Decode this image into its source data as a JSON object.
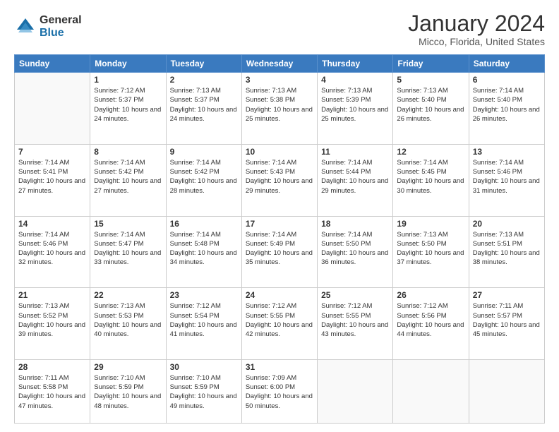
{
  "logo": {
    "general": "General",
    "blue": "Blue"
  },
  "title": "January 2024",
  "location": "Micco, Florida, United States",
  "weekdays": [
    "Sunday",
    "Monday",
    "Tuesday",
    "Wednesday",
    "Thursday",
    "Friday",
    "Saturday"
  ],
  "weeks": [
    [
      {
        "day": "",
        "info": ""
      },
      {
        "day": "1",
        "info": "Sunrise: 7:12 AM\nSunset: 5:37 PM\nDaylight: 10 hours\nand 24 minutes."
      },
      {
        "day": "2",
        "info": "Sunrise: 7:13 AM\nSunset: 5:37 PM\nDaylight: 10 hours\nand 24 minutes."
      },
      {
        "day": "3",
        "info": "Sunrise: 7:13 AM\nSunset: 5:38 PM\nDaylight: 10 hours\nand 25 minutes."
      },
      {
        "day": "4",
        "info": "Sunrise: 7:13 AM\nSunset: 5:39 PM\nDaylight: 10 hours\nand 25 minutes."
      },
      {
        "day": "5",
        "info": "Sunrise: 7:13 AM\nSunset: 5:40 PM\nDaylight: 10 hours\nand 26 minutes."
      },
      {
        "day": "6",
        "info": "Sunrise: 7:14 AM\nSunset: 5:40 PM\nDaylight: 10 hours\nand 26 minutes."
      }
    ],
    [
      {
        "day": "7",
        "info": "Sunrise: 7:14 AM\nSunset: 5:41 PM\nDaylight: 10 hours\nand 27 minutes."
      },
      {
        "day": "8",
        "info": "Sunrise: 7:14 AM\nSunset: 5:42 PM\nDaylight: 10 hours\nand 27 minutes."
      },
      {
        "day": "9",
        "info": "Sunrise: 7:14 AM\nSunset: 5:42 PM\nDaylight: 10 hours\nand 28 minutes."
      },
      {
        "day": "10",
        "info": "Sunrise: 7:14 AM\nSunset: 5:43 PM\nDaylight: 10 hours\nand 29 minutes."
      },
      {
        "day": "11",
        "info": "Sunrise: 7:14 AM\nSunset: 5:44 PM\nDaylight: 10 hours\nand 29 minutes."
      },
      {
        "day": "12",
        "info": "Sunrise: 7:14 AM\nSunset: 5:45 PM\nDaylight: 10 hours\nand 30 minutes."
      },
      {
        "day": "13",
        "info": "Sunrise: 7:14 AM\nSunset: 5:46 PM\nDaylight: 10 hours\nand 31 minutes."
      }
    ],
    [
      {
        "day": "14",
        "info": "Sunrise: 7:14 AM\nSunset: 5:46 PM\nDaylight: 10 hours\nand 32 minutes."
      },
      {
        "day": "15",
        "info": "Sunrise: 7:14 AM\nSunset: 5:47 PM\nDaylight: 10 hours\nand 33 minutes."
      },
      {
        "day": "16",
        "info": "Sunrise: 7:14 AM\nSunset: 5:48 PM\nDaylight: 10 hours\nand 34 minutes."
      },
      {
        "day": "17",
        "info": "Sunrise: 7:14 AM\nSunset: 5:49 PM\nDaylight: 10 hours\nand 35 minutes."
      },
      {
        "day": "18",
        "info": "Sunrise: 7:14 AM\nSunset: 5:50 PM\nDaylight: 10 hours\nand 36 minutes."
      },
      {
        "day": "19",
        "info": "Sunrise: 7:13 AM\nSunset: 5:50 PM\nDaylight: 10 hours\nand 37 minutes."
      },
      {
        "day": "20",
        "info": "Sunrise: 7:13 AM\nSunset: 5:51 PM\nDaylight: 10 hours\nand 38 minutes."
      }
    ],
    [
      {
        "day": "21",
        "info": "Sunrise: 7:13 AM\nSunset: 5:52 PM\nDaylight: 10 hours\nand 39 minutes."
      },
      {
        "day": "22",
        "info": "Sunrise: 7:13 AM\nSunset: 5:53 PM\nDaylight: 10 hours\nand 40 minutes."
      },
      {
        "day": "23",
        "info": "Sunrise: 7:12 AM\nSunset: 5:54 PM\nDaylight: 10 hours\nand 41 minutes."
      },
      {
        "day": "24",
        "info": "Sunrise: 7:12 AM\nSunset: 5:55 PM\nDaylight: 10 hours\nand 42 minutes."
      },
      {
        "day": "25",
        "info": "Sunrise: 7:12 AM\nSunset: 5:55 PM\nDaylight: 10 hours\nand 43 minutes."
      },
      {
        "day": "26",
        "info": "Sunrise: 7:12 AM\nSunset: 5:56 PM\nDaylight: 10 hours\nand 44 minutes."
      },
      {
        "day": "27",
        "info": "Sunrise: 7:11 AM\nSunset: 5:57 PM\nDaylight: 10 hours\nand 45 minutes."
      }
    ],
    [
      {
        "day": "28",
        "info": "Sunrise: 7:11 AM\nSunset: 5:58 PM\nDaylight: 10 hours\nand 47 minutes."
      },
      {
        "day": "29",
        "info": "Sunrise: 7:10 AM\nSunset: 5:59 PM\nDaylight: 10 hours\nand 48 minutes."
      },
      {
        "day": "30",
        "info": "Sunrise: 7:10 AM\nSunset: 5:59 PM\nDaylight: 10 hours\nand 49 minutes."
      },
      {
        "day": "31",
        "info": "Sunrise: 7:09 AM\nSunset: 6:00 PM\nDaylight: 10 hours\nand 50 minutes."
      },
      {
        "day": "",
        "info": ""
      },
      {
        "day": "",
        "info": ""
      },
      {
        "day": "",
        "info": ""
      }
    ]
  ]
}
